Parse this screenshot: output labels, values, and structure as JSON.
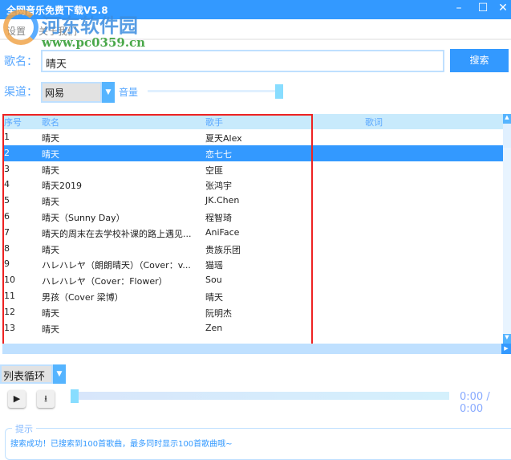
{
  "window": {
    "title": "全网音乐免费下载V5.8",
    "minimize": "–",
    "maximize": "☐",
    "close": "✕"
  },
  "watermark": {
    "name": "河东软件园",
    "url": "www.pc0359.cn"
  },
  "menu": [
    "设置",
    "关于我们"
  ],
  "search": {
    "label": "歌名：",
    "value": "晴天",
    "button": "搜索"
  },
  "channel": {
    "label": "渠道：",
    "value": "网易",
    "volume_label": "音量",
    "volume": 1.0
  },
  "table": {
    "headers": [
      "序号",
      "歌名",
      "歌手",
      "歌词"
    ],
    "selected_index": 1,
    "rows": [
      [
        "1",
        "晴天",
        "夏天Alex"
      ],
      [
        "2",
        "晴天",
        "恋七七"
      ],
      [
        "3",
        "晴天",
        "空匪"
      ],
      [
        "4",
        "晴天2019",
        "张鸿宇"
      ],
      [
        "5",
        "晴天",
        "JK.Chen"
      ],
      [
        "6",
        "晴天（Sunny Day）",
        "程智琦"
      ],
      [
        "7",
        "晴天的周末在去学校补课的路上遇见...",
        "AniFace"
      ],
      [
        "8",
        "晴天",
        "贵族乐团"
      ],
      [
        "9",
        "ハレハレヤ（朗朗晴天）（Cover：v...",
        "猫瑶"
      ],
      [
        "10",
        "ハレハレヤ（Cover：Flower）",
        "Sou"
      ],
      [
        "11",
        "男孩（Cover 梁博）",
        "晴天"
      ],
      [
        "12",
        "晴天",
        "阮明杰"
      ],
      [
        "13",
        "晴天",
        "Zen"
      ]
    ]
  },
  "player": {
    "mode": "列表循环",
    "time": "0:00 / 0:00",
    "progress": 0
  },
  "notice": {
    "title": "提示",
    "message": "搜索成功！已搜索到100首歌曲，最多同时显示100首歌曲哦~"
  }
}
